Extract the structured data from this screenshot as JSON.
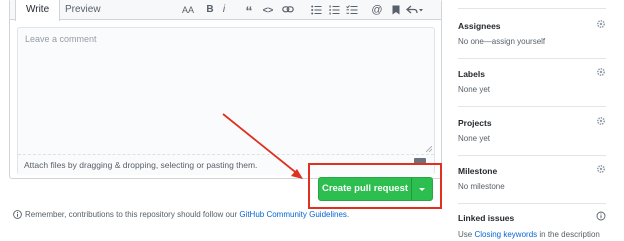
{
  "editor": {
    "tabs": [
      {
        "label": "Write",
        "active": true
      },
      {
        "label": "Preview",
        "active": false
      }
    ],
    "toolbar": {
      "header_icon_text": "AA",
      "bold_icon_text": "B",
      "italic_icon_text": "i",
      "quote_icon_text": "“",
      "code_icon_text": "<>",
      "link_icon_text": "⊘",
      "bullet_list_icon_text": "☰",
      "numbered_list_icon_text": "☷",
      "task_list_icon_text": "✓",
      "mention_icon_text": "@",
      "saved_replies_icon_text": "▮",
      "reply_icon_text": "↶▾"
    },
    "comment_placeholder": "Leave a comment",
    "comment_value": "",
    "attach_hint": "Attach files by dragging & dropping, selecting or pasting them."
  },
  "actions": {
    "create_pr_label": "Create pull request",
    "dropdown_caret": "▾",
    "accent_color": "#2cbe4e",
    "highlight_color": "#e0301e"
  },
  "note": {
    "prefix": "Remember, contributions to this repository should follow our ",
    "link_text": "GitHub Community Guidelines",
    "suffix": "."
  },
  "sidebar": {
    "assignees": {
      "title": "Assignees",
      "value": "No one—assign yourself"
    },
    "labels": {
      "title": "Labels",
      "value": "None yet"
    },
    "projects": {
      "title": "Projects",
      "value": "None yet"
    },
    "milestone": {
      "title": "Milestone",
      "value": "No milestone"
    },
    "linked_issues": {
      "title": "Linked issues",
      "value_prefix": "Use ",
      "value_link": "Closing keywords",
      "value_suffix": " in the description"
    }
  }
}
